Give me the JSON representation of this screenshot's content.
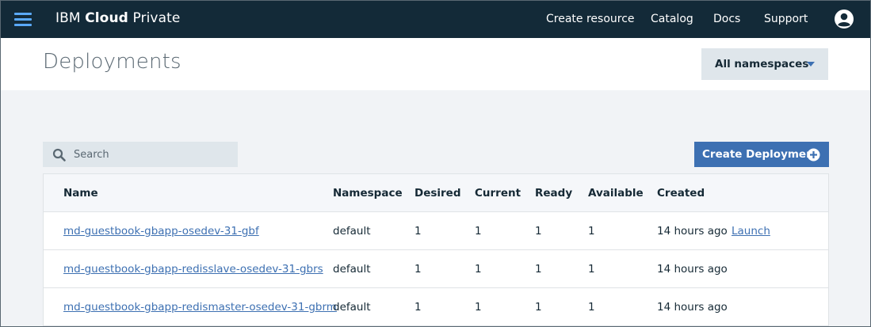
{
  "nav": {
    "brand_prefix": "IBM",
    "brand_bold": "Cloud",
    "brand_suffix": "Private",
    "links": [
      "Create resource",
      "Catalog",
      "Docs",
      "Support"
    ]
  },
  "page": {
    "title": "Deployments",
    "namespace_selected": "All namespaces"
  },
  "search": {
    "placeholder": "Search"
  },
  "create_button": {
    "label": "Create Deployment"
  },
  "table": {
    "columns": [
      "Name",
      "Namespace",
      "Desired",
      "Current",
      "Ready",
      "Available",
      "Created"
    ],
    "rows": [
      {
        "name": "md-guestbook-gbapp-osedev-31-gbf",
        "namespace": "default",
        "desired": "1",
        "current": "1",
        "ready": "1",
        "available": "1",
        "created": "14 hours ago",
        "action": "Launch"
      },
      {
        "name": "md-guestbook-gbapp-redisslave-osedev-31-gbrs",
        "namespace": "default",
        "desired": "1",
        "current": "1",
        "ready": "1",
        "available": "1",
        "created": "14 hours ago",
        "action": ""
      },
      {
        "name": "md-guestbook-gbapp-redismaster-osedev-31-gbrm",
        "namespace": "default",
        "desired": "1",
        "current": "1",
        "ready": "1",
        "available": "1",
        "created": "14 hours ago",
        "action": ""
      }
    ]
  },
  "colors": {
    "topbar": "#132a38",
    "accent": "#3d70b2",
    "hamburger": "#5aa9f8"
  }
}
